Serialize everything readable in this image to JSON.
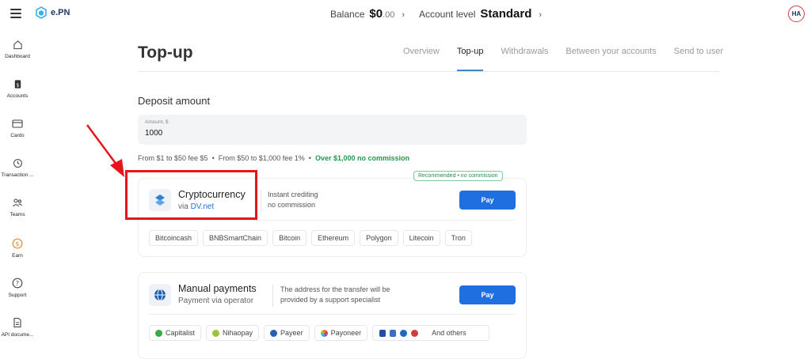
{
  "header": {
    "logo_text": "e.PN",
    "balance_label": "Balance",
    "balance_amount": "$0",
    "balance_cents": ".00",
    "account_level_label": "Account level",
    "account_level": "Standard",
    "avatar_initials": "HA"
  },
  "sidebar": {
    "items": [
      {
        "label": "Dashboard",
        "icon": "home-icon"
      },
      {
        "label": "Accounts",
        "icon": "accounts-icon"
      },
      {
        "label": "Cards",
        "icon": "card-icon"
      },
      {
        "label": "Transaction ...",
        "icon": "history-icon"
      },
      {
        "label": "Teams",
        "icon": "team-icon"
      },
      {
        "label": "Earn",
        "icon": "dollar-coin-icon"
      },
      {
        "label": "Support",
        "icon": "help-icon"
      },
      {
        "label": "API docume...",
        "icon": "document-icon"
      }
    ]
  },
  "main": {
    "title": "Top-up",
    "tabs": [
      {
        "label": "Overview",
        "active": false
      },
      {
        "label": "Top-up",
        "active": true
      },
      {
        "label": "Withdrawals",
        "active": false
      },
      {
        "label": "Between your accounts",
        "active": false
      },
      {
        "label": "Send to user",
        "active": false
      }
    ],
    "deposit_title": "Deposit amount",
    "amount_label": "Amount, $",
    "amount_value": "1000",
    "fees": {
      "tier1": "From $1 to $50 fee $5",
      "tier2": "From $50 to $1,000 fee 1%",
      "tier3": "Over $1,000 no commission",
      "separator": "•"
    }
  },
  "crypto": {
    "badge": "Recommended • no commission",
    "name": "Cryptocurrency",
    "via_prefix": "via ",
    "via_link": "DV.net",
    "desc_line1": "Instant crediting",
    "desc_line2": "no commission",
    "pay_label": "Pay",
    "chips": [
      "Bitcoincash",
      "BNBSmartChain",
      "Bitcoin",
      "Ethereum",
      "Polygon",
      "Litecoin",
      "Tron"
    ]
  },
  "manual": {
    "name": "Manual payments",
    "sub": "Payment via operator",
    "desc_line1": "The address for the transfer will be",
    "desc_line2": "provided by a support specialist",
    "pay_label": "Pay",
    "chips": [
      {
        "label": "Capitalist",
        "color": "#3aa847"
      },
      {
        "label": "Nihaopay",
        "color": "#9ac33c"
      },
      {
        "label": "Payeer",
        "color": "#2b5fb3"
      },
      {
        "label": "Payoneer",
        "color": "#f07b2a"
      }
    ],
    "others_label": "And others"
  },
  "colors": {
    "accent": "#1f6fe0",
    "success": "#1f9a4a",
    "annotation": "#e8141b"
  }
}
